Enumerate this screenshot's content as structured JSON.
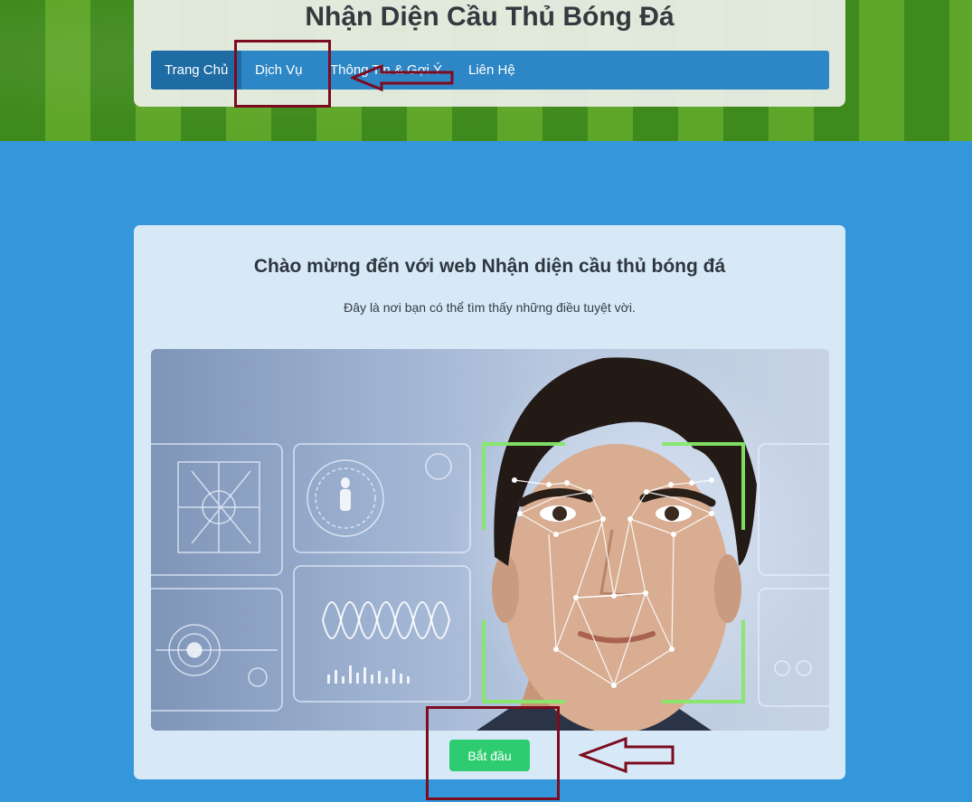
{
  "header": {
    "title": "Nhận Diện Cầu Thủ Bóng Đá"
  },
  "nav": {
    "items": [
      {
        "label": "Trang Chủ",
        "active": true
      },
      {
        "label": "Dịch Vụ",
        "active": false
      },
      {
        "label": "Thông Tin & Gợi Ý",
        "active": false
      },
      {
        "label": "Liên Hệ",
        "active": false
      }
    ]
  },
  "hero": {
    "heading": "Chào mừng đến với web Nhận diện cầu thủ bóng đá",
    "subtitle": "Đây là nơi bạn có thể tìm thấy những điều tuyệt vời.",
    "image": "face-recognition-illustration",
    "start_label": "Bắt đầu"
  },
  "colors": {
    "page_bg": "#3597db",
    "nav_bg": "#2d86c5",
    "nav_active": "#1f6ca5",
    "button": "#2ecc71",
    "annotation": "#7c0b1f"
  }
}
